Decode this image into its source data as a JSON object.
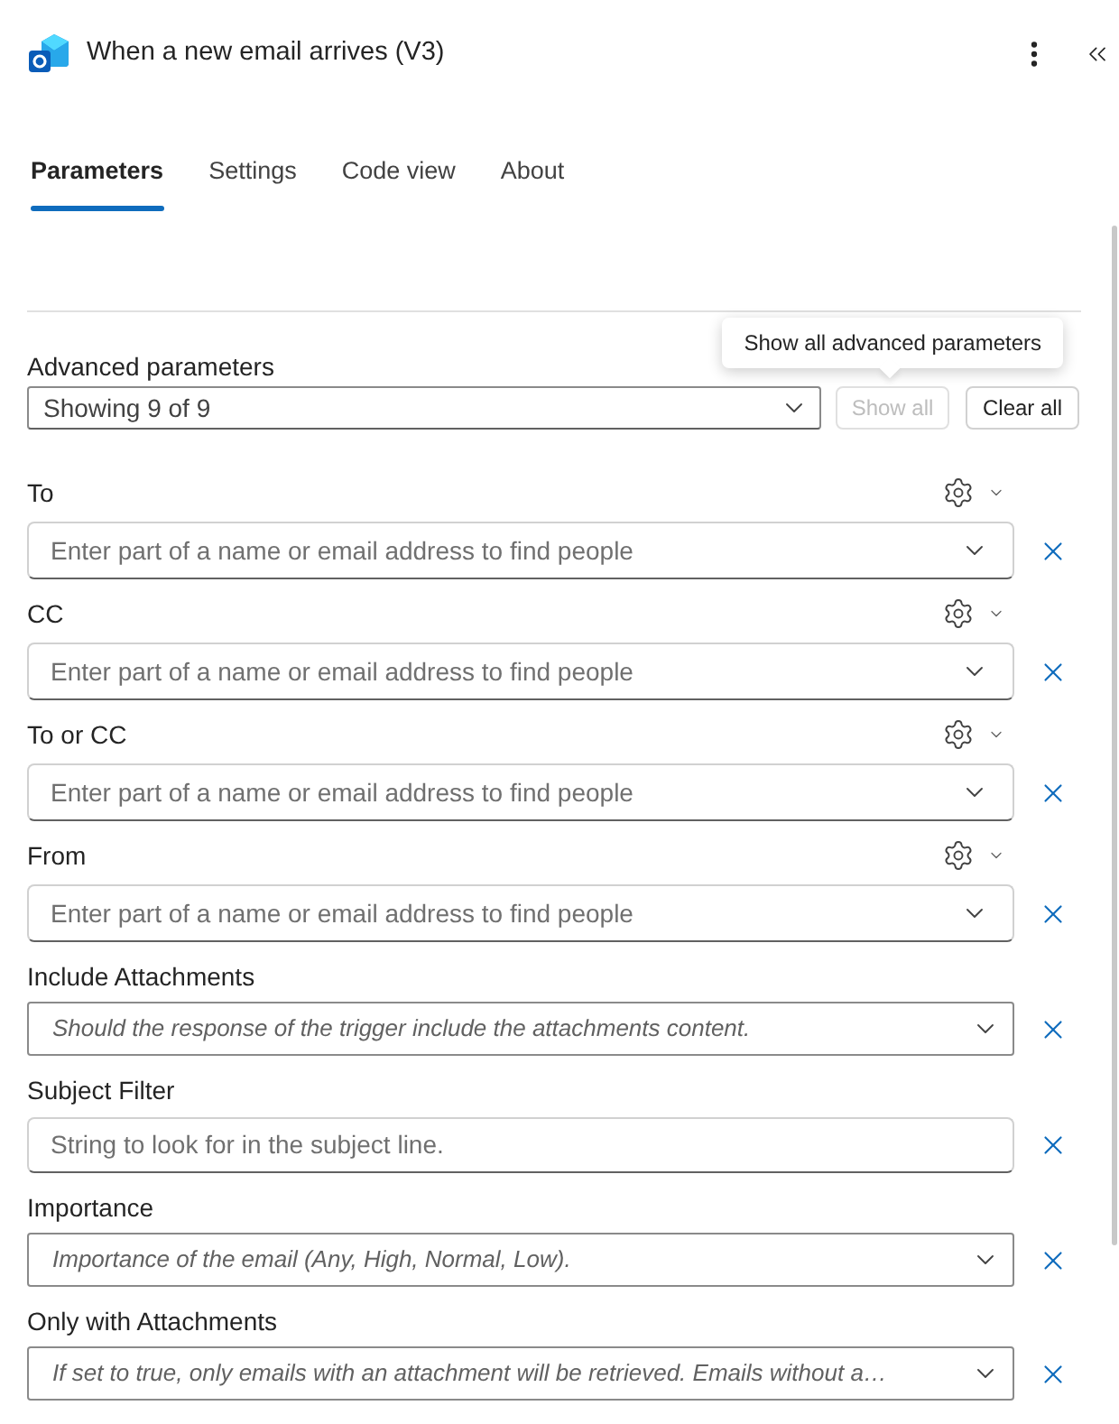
{
  "header": {
    "title": "When a new email arrives (V3)"
  },
  "tabs": [
    {
      "label": "Parameters",
      "selected": true
    },
    {
      "label": "Settings",
      "selected": false
    },
    {
      "label": "Code view",
      "selected": false
    },
    {
      "label": "About",
      "selected": false
    }
  ],
  "advanced": {
    "label": "Advanced parameters",
    "value": "Showing 9 of 9",
    "buttons": [
      {
        "label": "Show all",
        "disabled": true
      },
      {
        "label": "Clear all",
        "disabled": false
      }
    ],
    "tooltip": {
      "text": "Show all advanced parameters"
    }
  },
  "parameters": [
    {
      "label": "To",
      "kind": "people",
      "placeholder": "Enter part of a name or email address to find people"
    },
    {
      "label": "CC",
      "kind": "people",
      "placeholder": "Enter part of a name or email address to find people"
    },
    {
      "label": "To or CC",
      "kind": "people",
      "placeholder": "Enter part of a name or email address to find people"
    },
    {
      "label": "From",
      "kind": "people",
      "placeholder": "Enter part of a name or email address to find people"
    },
    {
      "label": "Include Attachments",
      "kind": "dropdown",
      "placeholder": "Should the response of the trigger include the attachments content."
    },
    {
      "label": "Subject Filter",
      "kind": "text",
      "placeholder": "String to look for in the subject line."
    },
    {
      "label": "Importance",
      "kind": "dropdown",
      "placeholder": "Importance of the email (Any, High, Normal, Low)."
    },
    {
      "label": "Only with Attachments",
      "kind": "dropdown",
      "placeholder": "If set to true, only emails with an attachment will be retrieved. Emails without a…"
    }
  ]
}
